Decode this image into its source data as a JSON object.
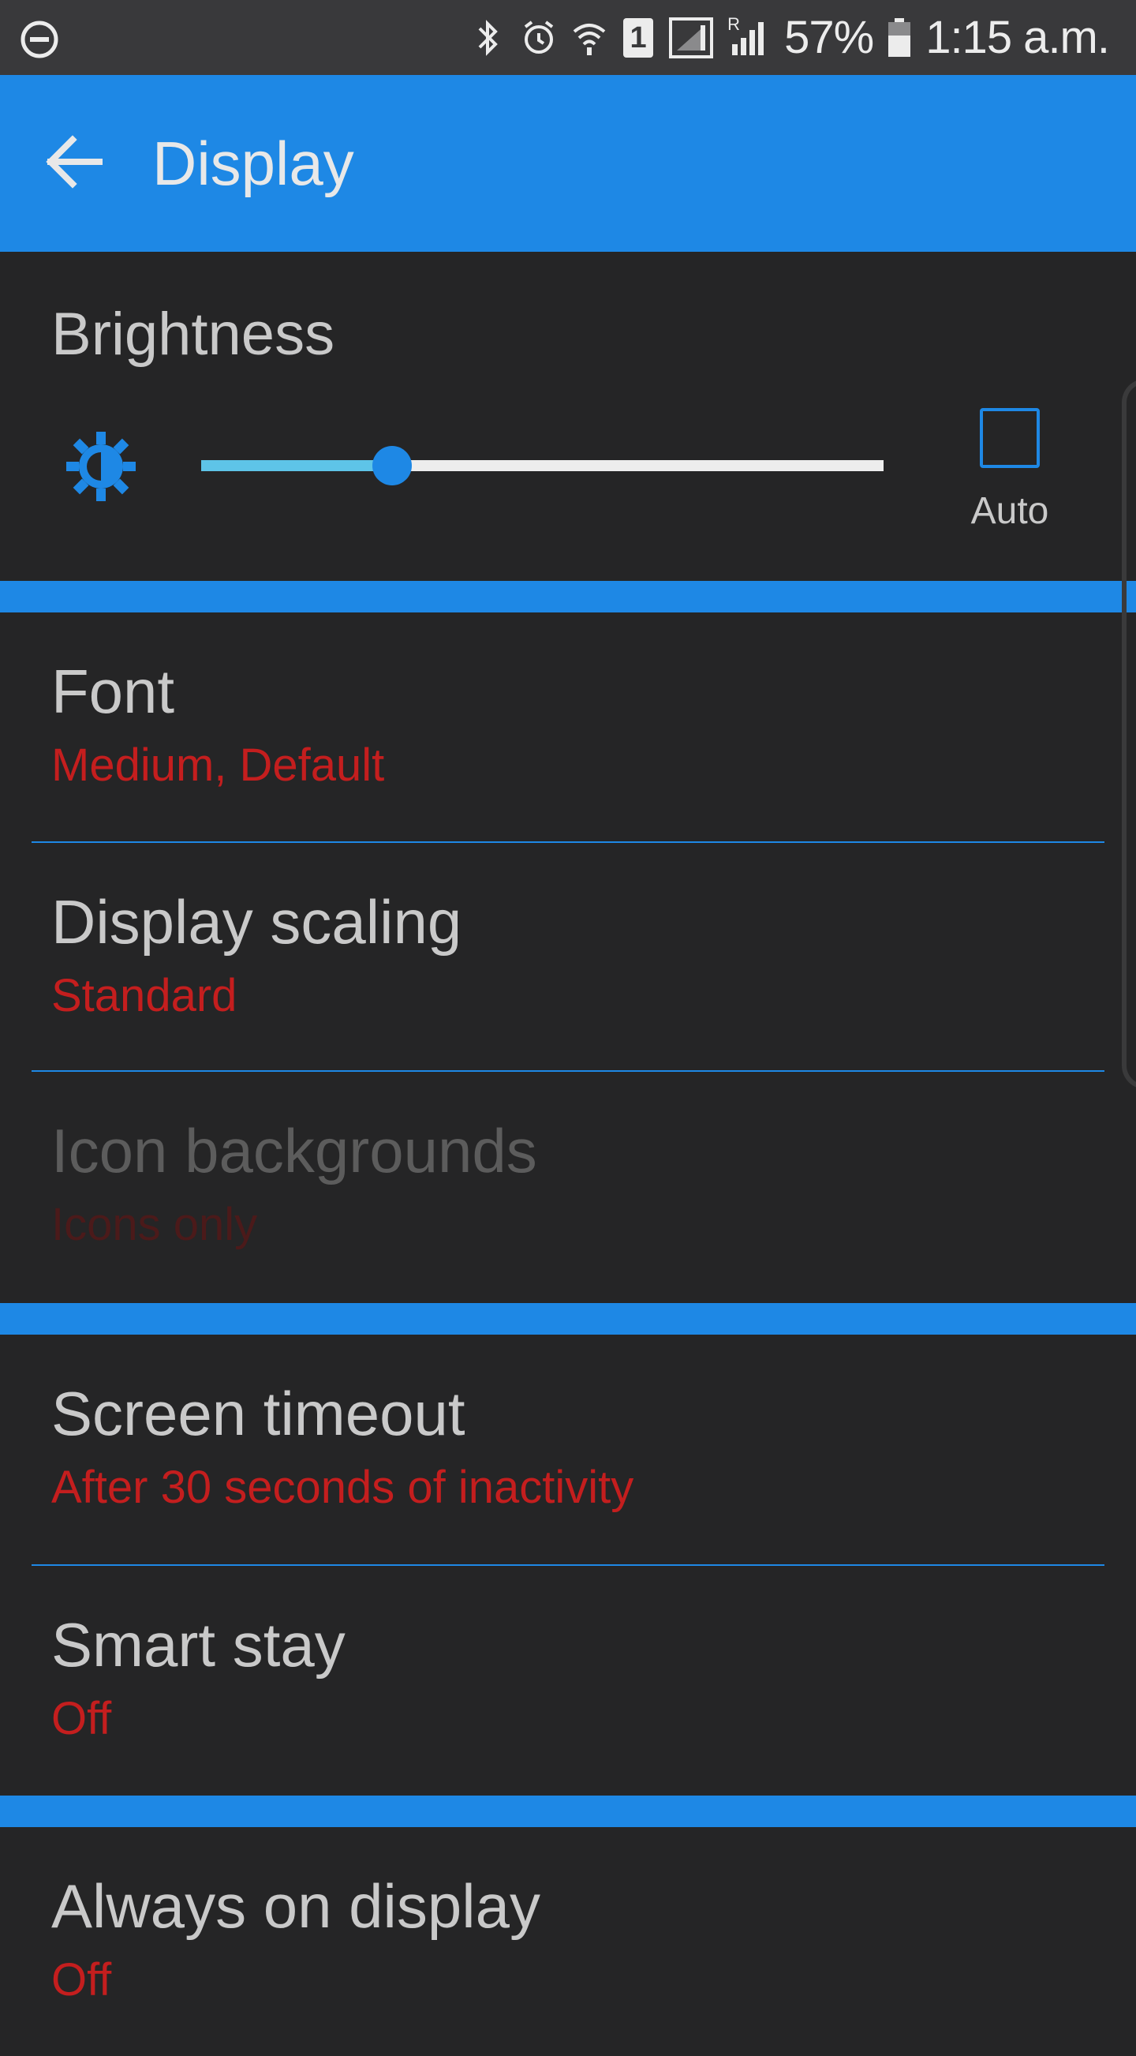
{
  "status_bar": {
    "battery": "57%",
    "time": "1:15 a.m.",
    "sim_badge": "1",
    "roaming_badge": "R",
    "icons": [
      "do-not-disturb-icon",
      "bluetooth-icon",
      "alarm-icon",
      "wifi-icon",
      "sim-icon",
      "signal-icon",
      "roaming-signal-icon",
      "battery-icon"
    ]
  },
  "app_bar": {
    "title": "Display",
    "back_icon": "arrow-back-icon"
  },
  "brightness": {
    "title": "Brightness",
    "level_fraction": 0.28,
    "auto_label": "Auto",
    "auto_checked": false,
    "icon": "brightness-sun-icon"
  },
  "items": [
    {
      "title": "Font",
      "subtitle": "Medium, Default",
      "enabled": true
    },
    {
      "title": "Display scaling",
      "subtitle": "Standard",
      "enabled": true
    },
    {
      "title": "Icon backgrounds",
      "subtitle": "Icons only",
      "enabled": false
    },
    {
      "title": "Screen timeout",
      "subtitle": "After 30 seconds of inactivity",
      "enabled": true
    },
    {
      "title": "Smart stay",
      "subtitle": "Off",
      "enabled": true
    },
    {
      "title": "Always on display",
      "subtitle": "Off",
      "enabled": true
    }
  ],
  "colors": {
    "accent": "#1e88e5",
    "background": "#252526",
    "title_text": "#c9c9c9",
    "subtitle_text": "#c41e1e",
    "slider_fill": "#5ec4e8"
  }
}
